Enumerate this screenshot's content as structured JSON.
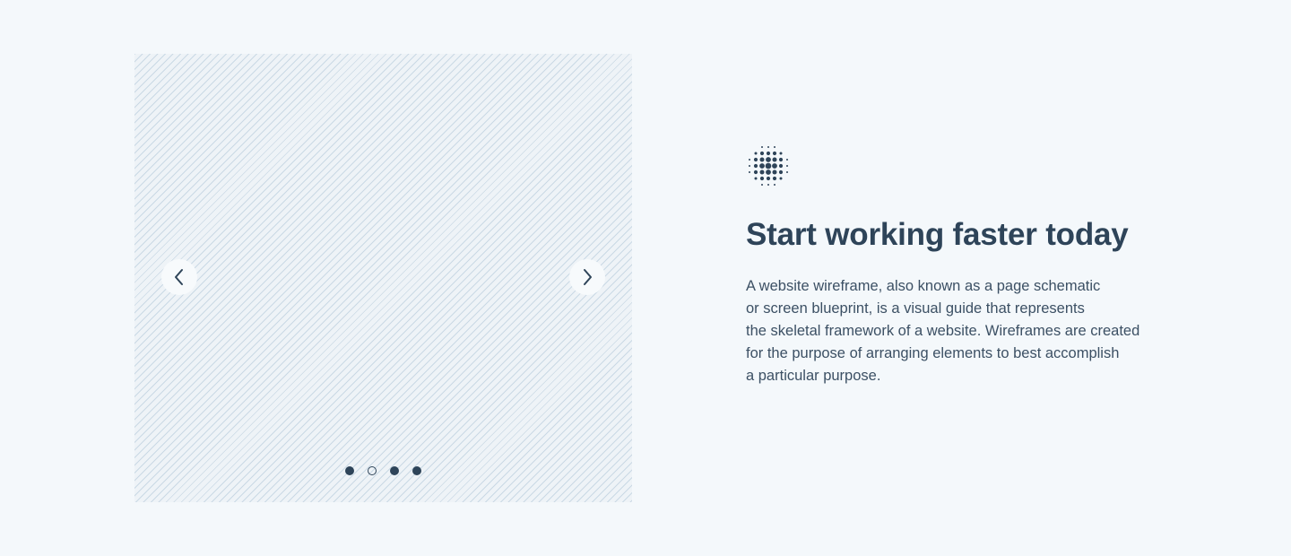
{
  "carousel": {
    "slide_count": 4,
    "active_dot_index": 1,
    "prev_icon": "chevron-left-icon",
    "next_icon": "chevron-right-icon"
  },
  "content": {
    "logo_icon": "dot-grid-logo-icon",
    "headline": "Start working faster today",
    "paragraph_lines": [
      "A website wireframe, also known as a page schematic",
      "or screen blueprint, is a visual guide that represents",
      "the skeletal framework of a website. Wireframes are created",
      "for the purpose of arranging elements to best accomplish",
      "a particular purpose."
    ]
  },
  "colors": {
    "background": "#F4F8FB",
    "text_dark": "#2E4459",
    "text_body": "#3C5064",
    "placeholder_stripe": "#ADC4D6"
  }
}
